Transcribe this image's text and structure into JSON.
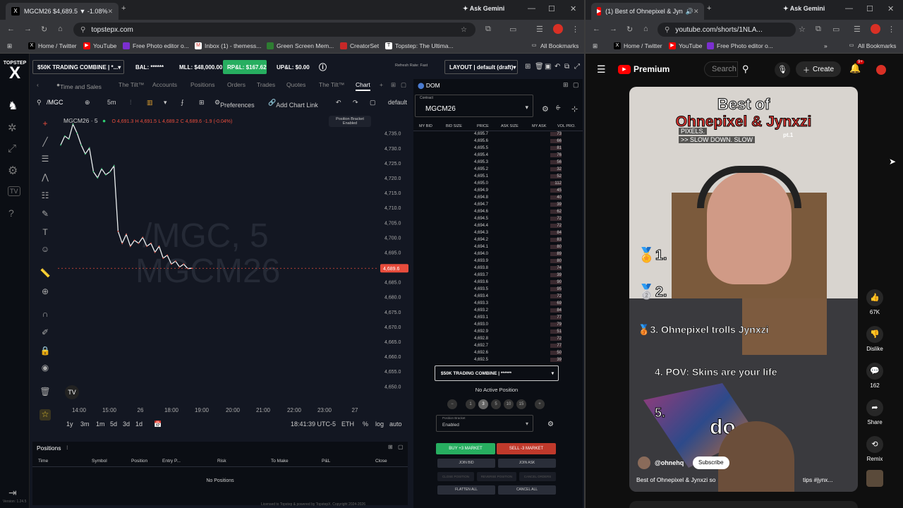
{
  "left_browser": {
    "tab_title": "MGCM26 $4,689.5 ▼ -1.08%",
    "new_tab": "+",
    "ask_gemini": "Ask Gemini",
    "url": "topstepx.com",
    "bookmarks": [
      "Home / Twitter",
      "YouTube",
      "Free Photo editor o...",
      "Inbox (1) - themess...",
      "Green Screen Mem...",
      "CreatorSet",
      "Topstep: The Ultima..."
    ],
    "all_bookmarks": "All Bookmarks"
  },
  "app": {
    "logo_top": "TOPSTEP",
    "logo_x": "X",
    "account": "$50K TRADING COMBINE | *...",
    "bal": "BAL: ******",
    "mll": "MLL: $48,000.00",
    "rpl": "RP&L: $167.62",
    "upl": "UP&L: $0.00",
    "refresh": "Refresh Rate: Fast",
    "layout": "LAYOUT | default (draft)",
    "tabs": [
      "Time and Sales",
      "The Tilt™",
      "Accounts",
      "Positions",
      "Orders",
      "Trades",
      "Quotes",
      "The Tilt™",
      "Chart"
    ],
    "chart_symbol": "/MGC",
    "timeframe": "5m",
    "preferences": "Preferences",
    "add_chart_link": "Add Chart Link",
    "default_label": "default",
    "legend_symbol": "MGCM26 · 5",
    "legend_o": "O 4,691.3",
    "legend_h": "H 4,691.5",
    "legend_l": "L 4,689.2",
    "legend_c": "C 4,689.6",
    "legend_chg": "-1.9 (-0.04%)",
    "position_bracket_title": "Position Bracket",
    "position_bracket_state": "Enabled",
    "watermark1": "/MGC, 5",
    "watermark2": "MGCM26",
    "price_label": "4,689.6",
    "time_readout": "18:41:39 UTC-5",
    "eth": "ETH",
    "pct": "%",
    "log": "log",
    "auto": "auto",
    "ranges": [
      "1y",
      "3m",
      "1m",
      "5d",
      "3d",
      "1d"
    ],
    "version": "Version: 1.24.5",
    "license": "Licensed to Topstep & powered by TopstepX. Copyright 2024-2026"
  },
  "chart_data": {
    "type": "line",
    "y_ticks": [
      "4,735.0",
      "4,730.0",
      "4,725.0",
      "4,720.0",
      "4,715.0",
      "4,710.0",
      "4,705.0",
      "4,700.0",
      "4,695.0",
      "4,690.0",
      "4,685.0",
      "4,680.0",
      "4,675.0",
      "4,670.0",
      "4,665.0",
      "4,660.0",
      "4,655.0",
      "4,650.0"
    ],
    "x_ticks": [
      "14:00",
      "15:00",
      "26",
      "18:00",
      "19:00",
      "20:00",
      "21:00",
      "22:00",
      "23:00",
      "27"
    ],
    "ylim": [
      4647,
      4738
    ],
    "x": [
      0,
      0.25,
      0.5,
      0.75,
      1,
      1.25,
      1.5,
      1.75,
      2,
      2.25,
      2.5,
      2.75,
      3,
      3.25,
      3.5,
      3.75,
      4,
      4.25,
      4.5,
      4.75,
      5,
      5.25,
      5.5,
      5.75,
      6,
      6.25,
      6.5,
      6.75,
      7,
      7.25,
      7.5,
      7.75,
      8
    ],
    "values": [
      4731,
      4734,
      4733,
      4738,
      4735,
      4731,
      4728,
      4730,
      4722,
      4720,
      4723,
      4721,
      4722,
      4724,
      4702,
      4698,
      4701,
      4697,
      4699,
      4698,
      4700,
      4697,
      4698,
      4695,
      4697,
      4693,
      4694,
      4691,
      4692,
      4690,
      4691,
      4689.5,
      4689.6
    ]
  },
  "dom": {
    "title": "DOM",
    "contract_label": "Contract",
    "contract": "MGCM26",
    "headers": [
      "MY BID",
      "BID SIZE",
      "PRICE",
      "ASK SIZE",
      "MY ASK",
      "VOL PRO."
    ],
    "rows": [
      {
        "price": "4,695.7",
        "ask": "73"
      },
      {
        "price": "4,695.6",
        "ask": "66"
      },
      {
        "price": "4,695.5",
        "ask": "81"
      },
      {
        "price": "4,695.4",
        "ask": "76"
      },
      {
        "price": "4,695.3",
        "ask": "56"
      },
      {
        "price": "4,695.2",
        "ask": "32"
      },
      {
        "price": "4,695.1",
        "ask": "52"
      },
      {
        "price": "4,695.0",
        "ask": "112"
      },
      {
        "price": "4,694.9",
        "ask": "45"
      },
      {
        "price": "4,694.8",
        "ask": "40"
      },
      {
        "price": "4,694.7",
        "ask": "39"
      },
      {
        "price": "4,694.6",
        "ask": "62"
      },
      {
        "price": "4,694.5",
        "ask": "72"
      },
      {
        "price": "4,694.4",
        "ask": "72"
      },
      {
        "price": "4,694.3",
        "ask": "84"
      },
      {
        "price": "4,694.2",
        "ask": "83"
      },
      {
        "price": "4,694.1",
        "ask": "80"
      },
      {
        "price": "4,694.0",
        "ask": "89"
      },
      {
        "price": "4,693.9",
        "ask": "80"
      },
      {
        "price": "4,693.8",
        "ask": "74"
      },
      {
        "price": "4,693.7",
        "ask": "39"
      },
      {
        "price": "4,693.6",
        "ask": "90"
      },
      {
        "price": "4,693.5",
        "ask": "95"
      },
      {
        "price": "4,693.4",
        "ask": "72"
      },
      {
        "price": "4,693.3",
        "ask": "69"
      },
      {
        "price": "4,693.2",
        "ask": "84"
      },
      {
        "price": "4,693.1",
        "ask": "77"
      },
      {
        "price": "4,693.0",
        "ask": "79"
      },
      {
        "price": "4,692.9",
        "ask": "51"
      },
      {
        "price": "4,692.8",
        "ask": "72"
      },
      {
        "price": "4,692.7",
        "ask": "77"
      },
      {
        "price": "4,692.6",
        "ask": "50"
      },
      {
        "price": "4,692.5",
        "ask": "39"
      }
    ],
    "account": "$50K TRADING COMBINE | ******",
    "no_active": "No Active Position",
    "qty": [
      "1",
      "3",
      "5",
      "10",
      "15"
    ],
    "bracket_label": "Position Bracket",
    "bracket_value": "Enabled",
    "buy": "BUY +3 MARKET",
    "sell": "SELL -3 MARKET",
    "join_bid": "JOIN BID",
    "join_ask": "JOIN ASK",
    "close_position": "CLOSE POSITION",
    "reverse_position": "REVERSE POSITION",
    "cancel_orders": "CANCEL ORDERS",
    "flatten": "FLATTEN ALL",
    "cancel_all": "CANCEL ALL"
  },
  "positions": {
    "title": "Positions",
    "headers": [
      "Time",
      "Symbol",
      "Position",
      "Entry P...",
      "Risk",
      "To Make",
      "P&L",
      "Close"
    ],
    "empty": "No Positions"
  },
  "right_browser": {
    "tab_title": "(1) Best of Ohnepixel & Jyn",
    "ask_gemini": "Ask Gemini",
    "url": "youtube.com/shorts/1NLA...",
    "bookmarks": [
      "Home / Twitter",
      "YouTube",
      "Free Photo editor o..."
    ],
    "all_bookmarks": "All Bookmarks"
  },
  "youtube": {
    "brand": "Premium",
    "search_placeholder": "Search",
    "create": "Create",
    "notif_count": "9+",
    "video_title_line1": "Best of",
    "video_title_line2": "Ohnepixel & Jynxzi",
    "video_pt": "pt.1",
    "caption1": "PIXELS.",
    "caption2": ">> SLOW DOWN. SLOW",
    "rank1": "1.",
    "rank2": "2.",
    "rank3": "3. Ohnepixel trolls Jynxzi",
    "rank4": "4. POV: Skins are your life",
    "rank5": "5.",
    "big_text": "do",
    "channel": "@ohnehq",
    "subscribe": "Subscribe",
    "short_title": "Best of Ohnepixel & Jynxzi so",
    "short_title_tail": "tips #jynx...",
    "likes": "67K",
    "dislike": "Dislike",
    "comments": "162",
    "share": "Share",
    "remix": "Remix"
  }
}
